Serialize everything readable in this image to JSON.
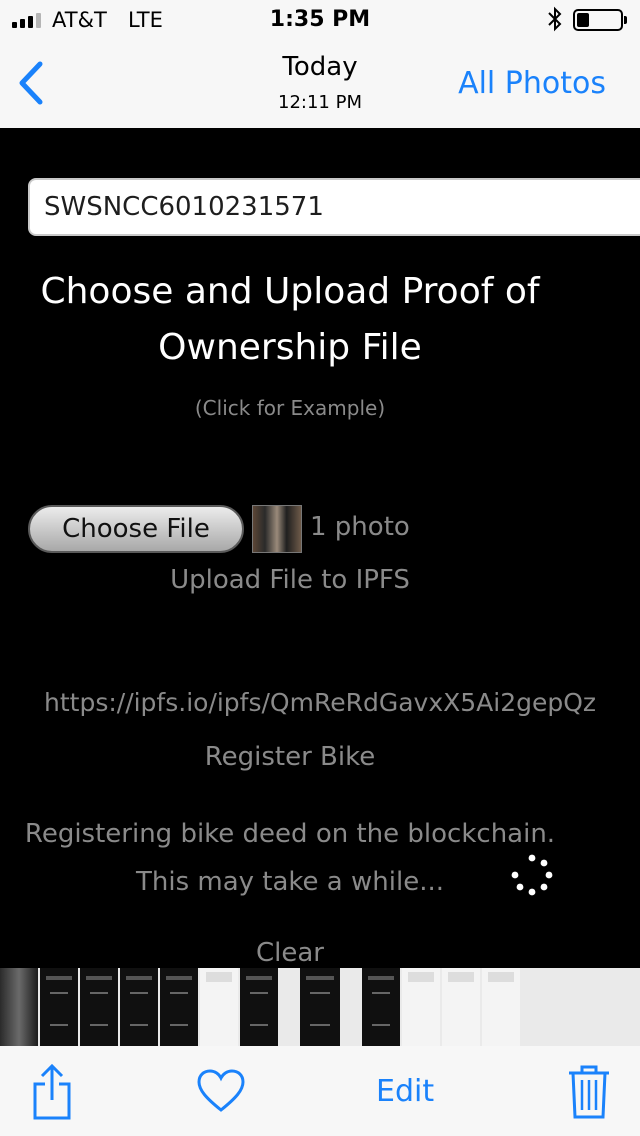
{
  "status_bar": {
    "carrier": "AT&T",
    "network": "LTE",
    "time": "1:35 PM",
    "signal_bars": 4,
    "signal_bars_filled": 3,
    "icons": [
      "signal-icon",
      "bluetooth-icon",
      "battery-icon"
    ]
  },
  "nav": {
    "back_icon": "chevron-left-icon",
    "title": "Today",
    "subtitle": "12:11 PM",
    "all_photos_label": "All Photos"
  },
  "photo_content": {
    "serial_input_value": "SWSNCC6010231571",
    "heading": "Choose and Upload Proof of Ownership File",
    "example_link": "(Click for Example)",
    "choose_file_label": "Choose File",
    "file_count": "1 photo",
    "upload_link": "Upload File to IPFS",
    "ipfs_url": "https://ipfs.io/ipfs/QmReRdGavxX5Ai2gepQz",
    "register_link": "Register Bike",
    "status_message": "Registering bike deed on the blockchain. This may take a while...",
    "clear_link": "Clear"
  },
  "toolbar": {
    "share_icon": "share-icon",
    "like_icon": "heart-icon",
    "edit_label": "Edit",
    "delete_icon": "trash-icon"
  },
  "colors": {
    "accent": "#1a82fb",
    "bar_background": "#f7f7f7",
    "photo_background": "#000000",
    "muted_text": "#8a8a8a"
  }
}
